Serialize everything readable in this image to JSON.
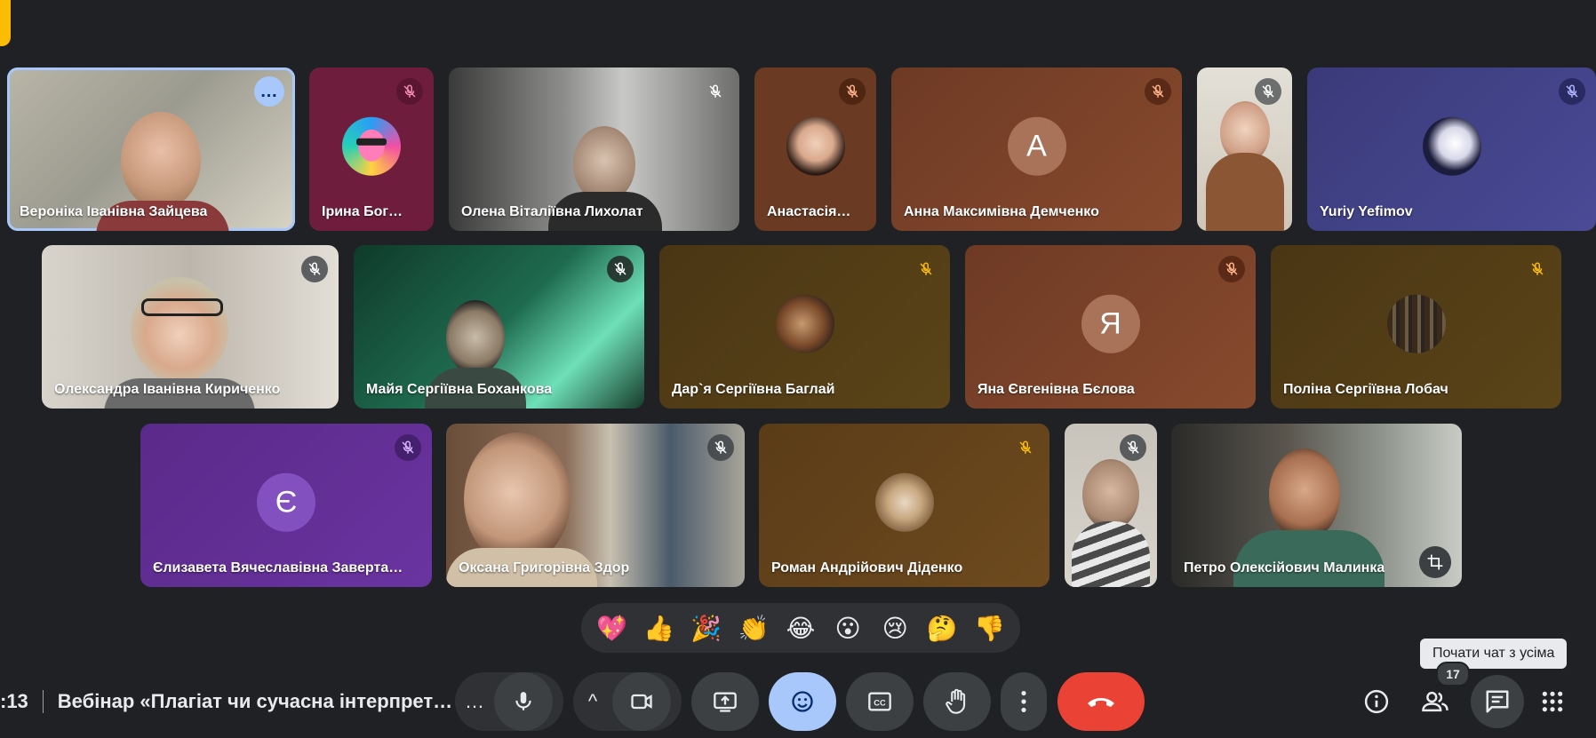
{
  "meeting": {
    "time_fragment": ":13",
    "title": "Вебінар «Плагіат чи сучасна інтерпрет…"
  },
  "participants": [
    {
      "name": "Вероніка Іванівна Зайцева",
      "muted": false,
      "active": true,
      "video": true
    },
    {
      "name": "Ірина Бог…",
      "muted": true,
      "video": false,
      "avatar": "illustrated-avatar"
    },
    {
      "name": "Олена Віталіївна Лихолат",
      "muted": true,
      "video": true
    },
    {
      "name": "Анастасія…",
      "muted": true,
      "video": false,
      "avatar": "photo-avatar"
    },
    {
      "name": "Анна Максимівна Демченко",
      "muted": true,
      "video": false,
      "initial": "A"
    },
    {
      "name": "",
      "muted": true,
      "video": true
    },
    {
      "name": "Yuriy Yefimov",
      "muted": true,
      "video": false,
      "avatar": "portrait-avatar"
    },
    {
      "name": "Олександра Іванівна Кириченко",
      "muted": true,
      "video": true
    },
    {
      "name": "Майя Сергіївна Боханкова",
      "muted": true,
      "video": true
    },
    {
      "name": "Дар`я Сергіївна Баглай",
      "muted": true,
      "video": false,
      "avatar": "photo-avatar"
    },
    {
      "name": "Яна Євгенівна Бєлова",
      "muted": true,
      "video": false,
      "initial": "Я"
    },
    {
      "name": "Поліна Сергіївна Лобач",
      "muted": true,
      "video": false,
      "avatar": "photo-avatar"
    },
    {
      "name": "Єлизавета Вячеславівна Заверта…",
      "muted": true,
      "video": false,
      "initial": "Є"
    },
    {
      "name": "Оксана Григорівна Здор",
      "muted": true,
      "video": true
    },
    {
      "name": "Роман Андрійович Діденко",
      "muted": true,
      "video": false,
      "avatar": "cat-avatar"
    },
    {
      "name": "",
      "muted": true,
      "video": true
    },
    {
      "name": "Петро Олексійович Малинка",
      "muted": false,
      "video": true
    }
  ],
  "reactions": [
    "💖",
    "👍",
    "🎉",
    "👏",
    "😂",
    "😮",
    "😢",
    "🤔",
    "👎"
  ],
  "controls": {
    "more_options": "…",
    "chevron": "^"
  },
  "people_count": "17",
  "tooltip": "Почати чат з усіма",
  "colors": {
    "background": "#202124",
    "accent_blue": "#a8c7fa",
    "end_call_red": "#ea4335",
    "meet_yellow": "#fbbc04"
  }
}
